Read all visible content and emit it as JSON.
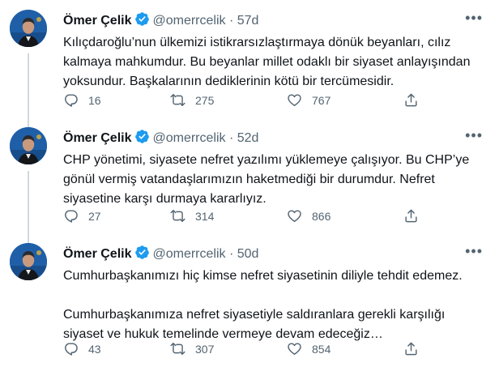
{
  "tweets": [
    {
      "name": "Ömer Çelik",
      "handle": "@omerrcelik",
      "separator": "·",
      "time": "57d",
      "text": "Kılıçdaroğlu’nun ülkemizi  istikrarsızlaştırmaya dönük beyanları, cılız kalmaya mahkumdur. Bu beyanlar millet odaklı bir siyaset anlayışından yoksundur. Başkalarının dediklerinin kötü bir tercümesidir.",
      "replies": "16",
      "retweets": "275",
      "likes": "767"
    },
    {
      "name": "Ömer Çelik",
      "handle": "@omerrcelik",
      "separator": "·",
      "time": "52d",
      "text": "CHP yönetimi, siyasete nefret yazılımı yüklemeye çalışıyor. Bu CHP’ye gönül vermiş vatandaşlarımızın haketmediği bir durumdur. Nefret siyasetine karşı durmaya kararlıyız.",
      "replies": "27",
      "retweets": "314",
      "likes": "866"
    },
    {
      "name": "Ömer Çelik",
      "handle": "@omerrcelik",
      "separator": "·",
      "time": "50d",
      "text": "Cumhurbaşkanımızı hiç kimse nefret siyasetinin diliyle tehdit edemez.\n\nCumhurbaşkanımıza nefret siyasetiyle saldıranlara gerekli karşılığı  siyaset ve hukuk  temelinde vermeye devam edeceğiz…",
      "replies": "43",
      "retweets": "307",
      "likes": "854"
    }
  ],
  "colors": {
    "verified": "#1d9bf0",
    "secondary_text": "#536471",
    "thread_line": "#cfd9de",
    "avatar_bg": "#1f5fa8"
  },
  "icons": [
    "verified-badge-icon",
    "reply-icon",
    "retweet-icon",
    "like-icon",
    "share-icon",
    "more-icon"
  ]
}
